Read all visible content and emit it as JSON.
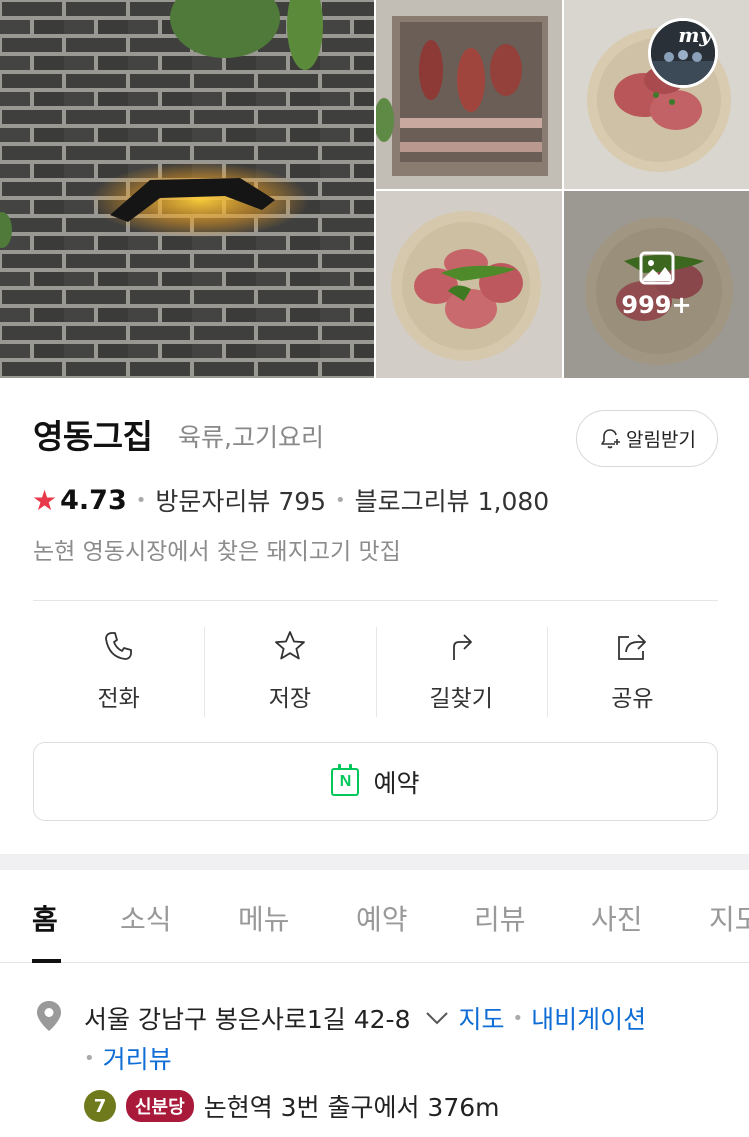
{
  "gallery": {
    "more_count": "999+",
    "my_badge": "my"
  },
  "place": {
    "name": "영동그집",
    "category": "육류,고기요리",
    "alarm_label": "알림받기",
    "rating": "4.73",
    "visitor_review_label": "방문자리뷰",
    "visitor_review_count": "795",
    "blog_review_label": "블로그리뷰",
    "blog_review_count": "1,080",
    "description": "논현 영동시장에서 찾은 돼지고기 맛집"
  },
  "actions": [
    {
      "label": "전화",
      "icon": "phone-icon"
    },
    {
      "label": "저장",
      "icon": "star-icon"
    },
    {
      "label": "길찾기",
      "icon": "directions-icon"
    },
    {
      "label": "공유",
      "icon": "share-icon"
    }
  ],
  "reserve": {
    "label": "예약",
    "icon": "naver-booking-icon",
    "icon_letter": "N"
  },
  "tabs": [
    "홈",
    "소식",
    "메뉴",
    "예약",
    "리뷰",
    "사진",
    "지도"
  ],
  "active_tab": "홈",
  "address": {
    "text": "서울 강남구 봉은사로1길 42-8",
    "links": [
      "지도",
      "내비게이션",
      "거리뷰"
    ]
  },
  "subway": {
    "line_number": "7",
    "line_name": "신분당",
    "text": "논현역 3번 출구에서 376m"
  },
  "colors": {
    "star": "#e8394a",
    "link": "#0f6dd6",
    "naver_green": "#03c75a",
    "line7": "#6f7a1c",
    "shinbundang": "#a8193a"
  }
}
